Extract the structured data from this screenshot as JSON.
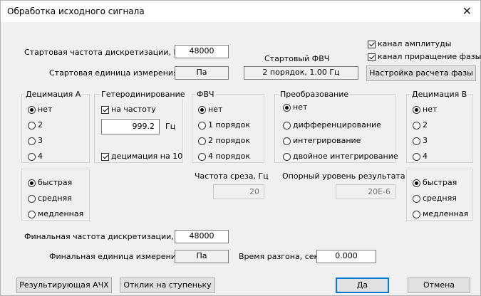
{
  "window": {
    "title": "Обработка исходного сигнала"
  },
  "top": {
    "start_rate_label": "Стартовая частота дискретизации, Гц",
    "start_rate_value": "48000",
    "start_unit_label": "Стартовая единица измерения",
    "start_unit_value": "Па",
    "hpf_label": "Стартовый ФВЧ",
    "hpf_value": "2 порядок, 1.00 Гц",
    "chk_amplitude": "канал амплитуды",
    "chk_phase": "канал приращение фазы",
    "phase_button": "Настройка расчета фазы"
  },
  "decim_a": {
    "title": "Децимация А",
    "options": [
      "нет",
      "2",
      "3",
      "4"
    ],
    "selected": "нет"
  },
  "hetero": {
    "title": "Гетеродинирование",
    "freq_chk": "на частоту",
    "freq_value": "999.2",
    "freq_unit": "Гц",
    "decim_chk": "децимация на 10"
  },
  "fvch": {
    "title": "ФВЧ",
    "options": [
      "нет",
      "1 порядок",
      "2 порядок",
      "4 порядок"
    ],
    "selected": "нет"
  },
  "transform": {
    "title": "Преобразование",
    "options": [
      "нет",
      "дифференцирование",
      "интегрирование",
      "двойное интегрирование"
    ],
    "selected": "нет"
  },
  "decim_b": {
    "title": "Децимация В",
    "options": [
      "нет",
      "2",
      "3",
      "4"
    ],
    "selected": "нет"
  },
  "speed_a": {
    "options": [
      "быстрая",
      "средняя",
      "медленная"
    ],
    "selected": "быстрая"
  },
  "speed_b": {
    "options": [
      "быстрая",
      "средняя",
      "медленная"
    ],
    "selected": "быстрая"
  },
  "cutoff": {
    "label": "Частота среза, Гц",
    "value": "20"
  },
  "ref_level": {
    "label": "Опорный уровень результата",
    "value": "20E-6"
  },
  "bottom": {
    "final_rate_label": "Финальная частота дискретизации, Гц",
    "final_rate_value": "48000",
    "final_unit_label": "Финальная единица измерения",
    "final_unit_value": "Па",
    "accel_label": "Время разгона, сек",
    "accel_value": "0.000"
  },
  "buttons": {
    "afc": "Результирующая АЧХ",
    "step": "Отклик на ступеньку",
    "ok": "Да",
    "cancel": "Отмена"
  }
}
